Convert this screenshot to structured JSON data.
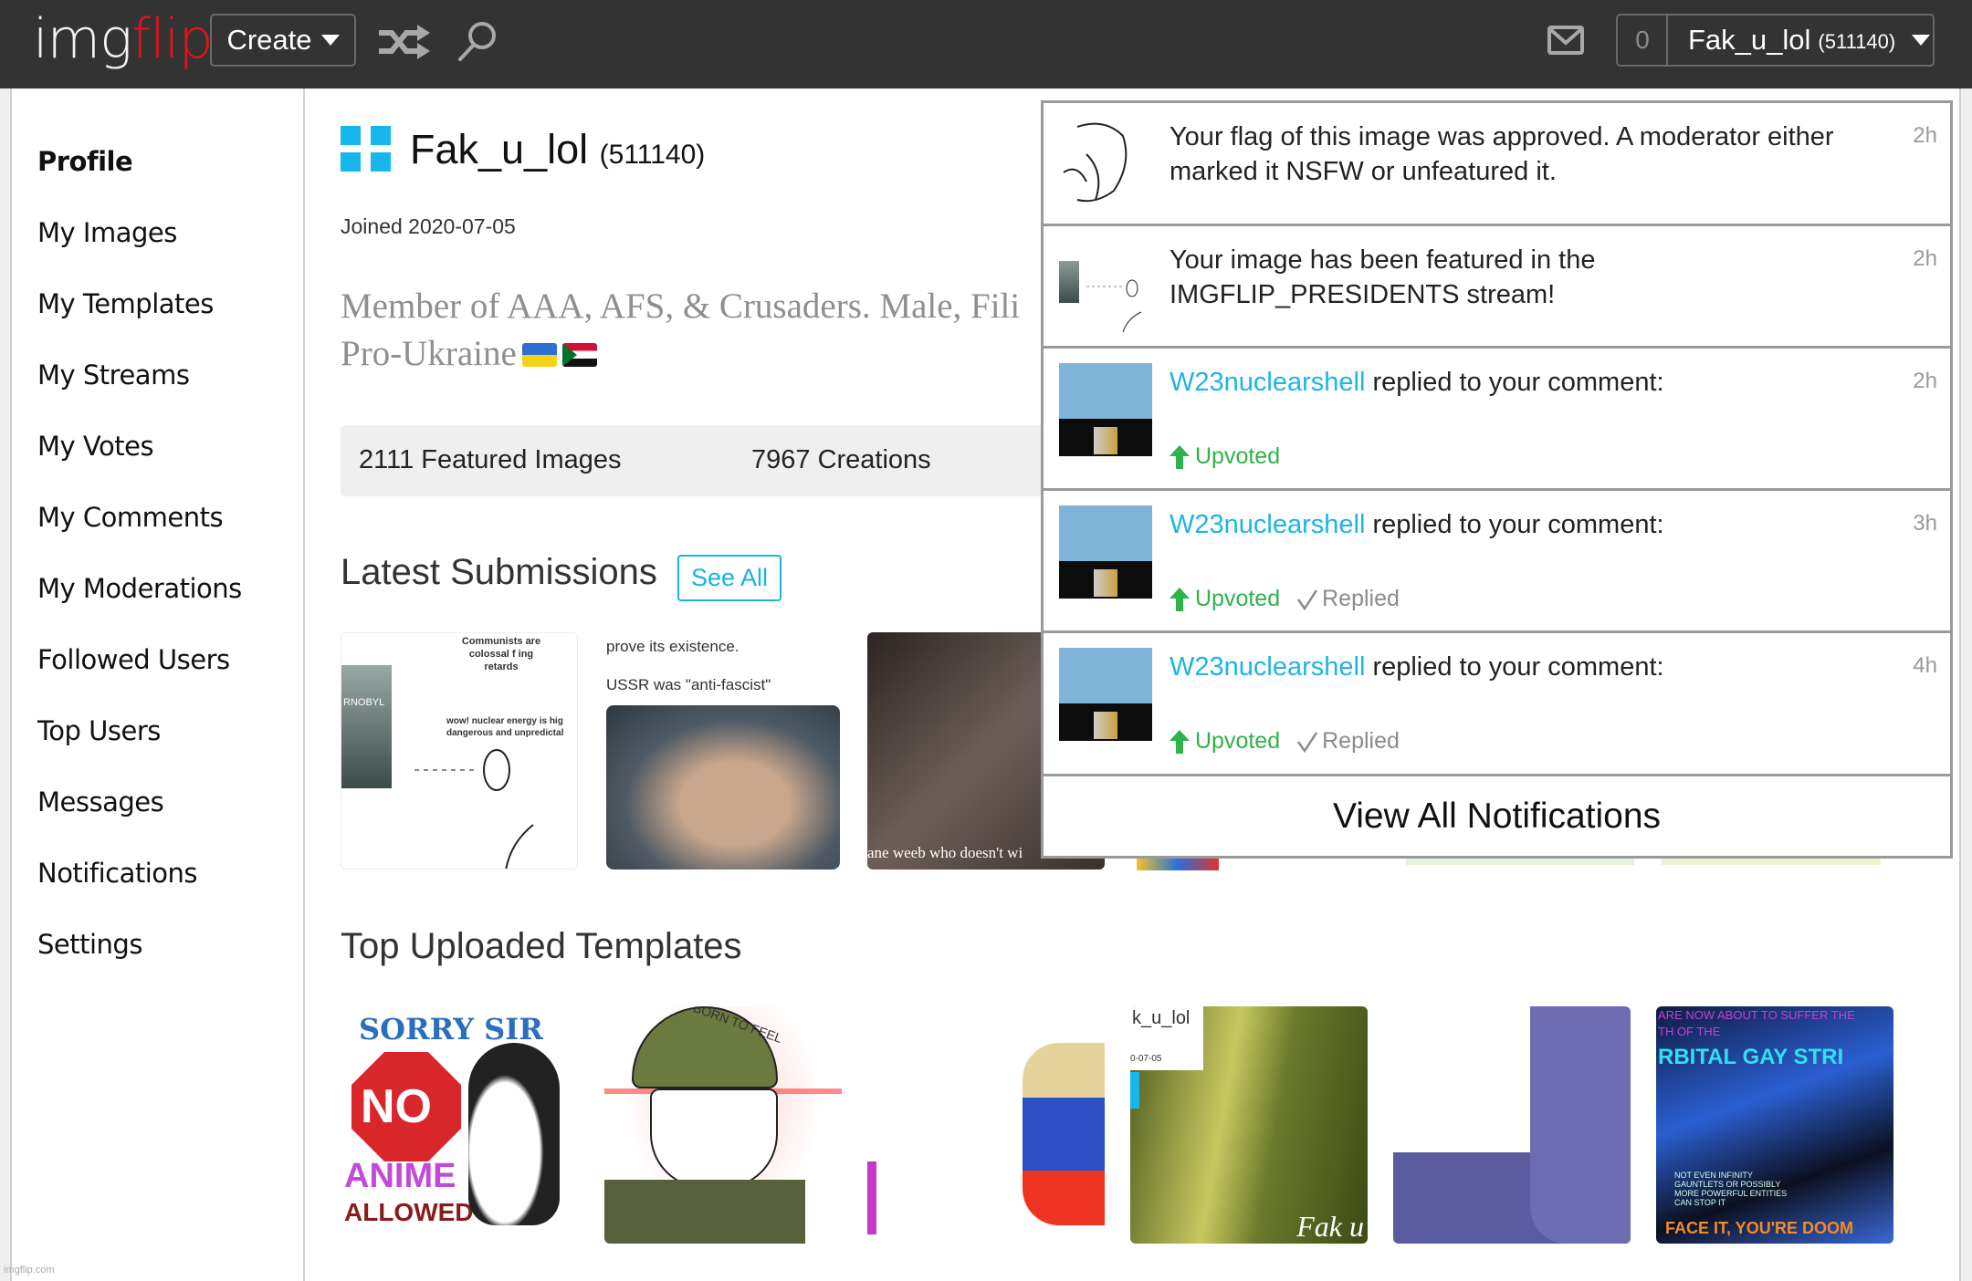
{
  "header": {
    "logo_part1": "img",
    "logo_part2": "flip",
    "create_label": "Create",
    "notification_count": "0",
    "username": "Fak_u_lol",
    "user_points": "(511140)",
    "icons": [
      "shuffle-icon",
      "search-icon",
      "mail-icon",
      "caret-down-icon"
    ]
  },
  "sidebar": {
    "items": [
      {
        "label": "Profile",
        "active": true
      },
      {
        "label": "My Images"
      },
      {
        "label": "My Templates"
      },
      {
        "label": "My Streams"
      },
      {
        "label": "My Votes"
      },
      {
        "label": "My Comments"
      },
      {
        "label": "My Moderations"
      },
      {
        "label": "Followed Users"
      },
      {
        "label": "Top Users"
      },
      {
        "label": "Messages"
      },
      {
        "label": "Notifications"
      },
      {
        "label": "Settings"
      }
    ],
    "watermark": "imgflip.com"
  },
  "profile": {
    "username": "Fak_u_lol",
    "points": "(511140)",
    "joined": "Joined 2020-07-05",
    "bio_line1": "Member of AAA, AFS, & Crusaders. Male, Fili",
    "bio_line2": "Pro-Ukraine",
    "flags": [
      "Ukraine",
      "Sudan"
    ],
    "accent_color": "#17b6ec"
  },
  "stats": {
    "featured": "2111 Featured Images",
    "creations": "7967 Creations"
  },
  "latest": {
    "heading": "Latest Submissions",
    "see_all": "See All",
    "thumbs": [
      {
        "caption_top": "Communists are colossal f    ing retards",
        "caption_mid": "wow! nuclear energy is hig dangerous and unpredictal",
        "side": "RNOBYL"
      },
      {
        "caption_top": "prove its existence.",
        "caption_mid": "USSR was \"anti-fascist\""
      },
      {
        "caption_bottom": "ane weeb who doesn't wi"
      }
    ]
  },
  "templates": {
    "heading": "Top Uploaded Templates",
    "thumbs": [
      {
        "text": [
          "SORRY SIR",
          "NO",
          "ANIME",
          "ALLOWED"
        ]
      },
      {
        "text": [
          "BORN TO FEEL"
        ]
      },
      {
        "text": []
      },
      {
        "text": [
          "k_u_lol",
          "0-07-05",
          "Fak u"
        ]
      },
      {
        "text": []
      },
      {
        "text": [
          "ARE NOW ABOUT TO SUFFER THE",
          "TH OF THE",
          "RBITAL GAY STRI",
          "NOT EVEN INFINITY GAUNTLETS OR POSSIBLY MORE POWERFUL ENTITIES CAN STOP IT",
          "FACE IT, YOU'RE DOOM"
        ]
      }
    ]
  },
  "notifications": {
    "items": [
      {
        "text": "Your flag of this image was approved. A moderator either marked it NSFW or unfeatured it.",
        "time": "2h"
      },
      {
        "text": "Your image has been featured in the IMGFLIP_PRESIDENTS stream!",
        "time": "2h"
      },
      {
        "user": "W23nuclearshell",
        "text": " replied to your comment:",
        "time": "2h",
        "upvoted": "Upvoted"
      },
      {
        "user": "W23nuclearshell",
        "text": " replied to your comment:",
        "time": "3h",
        "upvoted": "Upvoted",
        "replied": "Replied"
      },
      {
        "user": "W23nuclearshell",
        "text": " replied to your comment:",
        "time": "4h",
        "upvoted": "Upvoted",
        "replied": "Replied"
      }
    ],
    "view_all": "View All Notifications",
    "link_color": "#1db4e6",
    "upvote_color": "#2fb24a"
  }
}
